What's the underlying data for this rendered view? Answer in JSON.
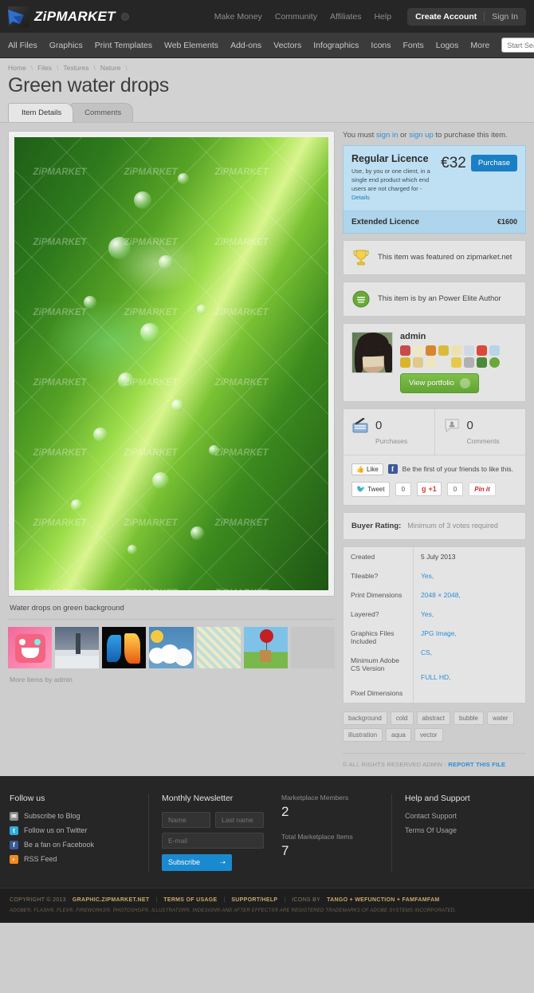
{
  "header": {
    "logo_text": "ZiPMARKET",
    "top_links": [
      "Make Money",
      "Community",
      "Affiliates",
      "Help"
    ],
    "create_account": "Create Account",
    "sign_in": "Sign In"
  },
  "nav": {
    "items": [
      "All Files",
      "Graphics",
      "Print Templates",
      "Web Elements",
      "Add-ons",
      "Vectors",
      "Infographics",
      "Icons",
      "Fonts",
      "Logos",
      "More"
    ],
    "search_placeholder": "Start Searching...",
    "search_value": ""
  },
  "breadcrumb": [
    "Home",
    "Files",
    "Textures",
    "Nature"
  ],
  "page_title": "Green water drops",
  "tabs": [
    {
      "label": "Item Details",
      "active": true
    },
    {
      "label": "Comments",
      "active": false
    }
  ],
  "preview": {
    "watermark": "ZiPMARKET",
    "caption": "Water drops on green background",
    "more_items": "More items by admin"
  },
  "purchase": {
    "notice_prefix": "You must ",
    "sign_in": "sign in",
    "notice_mid": " or ",
    "sign_up": "sign up",
    "notice_suffix": " to purchase this item.",
    "regular_title": "Regular Licence",
    "regular_desc": "Use, by you or one client, in a single end product which end users are not charged for -",
    "details_link": "Details",
    "regular_price": "€32",
    "purchase_label": "Purchase",
    "extended_title": "Extended Licence",
    "extended_price": "€1600"
  },
  "badges": {
    "featured": "This item was featured on zipmarket.net",
    "elite": "This item is by an Power Elite Author"
  },
  "author": {
    "name": "admin",
    "portfolio_label": "View portfolio",
    "badge_colors": [
      "#c94a4a",
      "#e8d88a",
      "#d9852e",
      "#d9bb3a",
      "#eae3b0",
      "#cfd9e2",
      "#d94a3a",
      "#b8d4e8",
      "#d9b52e",
      "#e0c98a",
      "#efe6c0",
      "#e4e4e4",
      "#e8c84a",
      "#b0b0b0",
      "#4a8a3a",
      "#6aa83a"
    ]
  },
  "stats": {
    "purchases_count": "0",
    "purchases_label": "Purchases",
    "comments_count": "0",
    "comments_label": "Comments"
  },
  "social": {
    "like_label": "Like",
    "fb_note": "Be the first of your friends to like this.",
    "tweet_label": "Tweet",
    "tweet_count": "0",
    "gplus_label": "+1",
    "gplus_count": "0",
    "pin_label": "Pin it"
  },
  "rating": {
    "label": "Buyer Rating:",
    "value": "Minimum of 3 votes required"
  },
  "attributes": [
    {
      "name": "Created",
      "value": "5 July 2013",
      "link": false
    },
    {
      "name": "Tileable?",
      "value": "Yes,",
      "link": true
    },
    {
      "name": "Print Dimensions",
      "value": "2048 × 2048,",
      "link": true
    },
    {
      "name": "Layered?",
      "value": "Yes,",
      "link": true
    },
    {
      "name": "Graphics Files Included",
      "value": "JPG Image,",
      "link": true
    },
    {
      "name": "Minimum Adobe CS Version",
      "value": "CS,",
      "link": true
    },
    {
      "name": "Pixel Dimensions",
      "value": "FULL HD,",
      "link": true
    }
  ],
  "tags": [
    "background",
    "cold",
    "abstract",
    "bubble",
    "water",
    "illustration",
    "aqua",
    "vector"
  ],
  "rights": {
    "text": "© ALL RIGHTS RESERVED ADMIN - ",
    "report_link": "REPORT THIS FILE"
  },
  "footer": {
    "follow_head": "Follow us",
    "follow_links": [
      {
        "label": "Subscribe to Blog",
        "color": "#8a8a8a",
        "glyph": "✉"
      },
      {
        "label": "Follow us on Twitter",
        "color": "#2daae1",
        "glyph": "t"
      },
      {
        "label": "Be a fan on Facebook",
        "color": "#3b5998",
        "glyph": "f"
      },
      {
        "label": "RSS Feed",
        "color": "#f28a1e",
        "glyph": "◔"
      }
    ],
    "newsletter_head": "Monthly Newsletter",
    "name_placeholder": "Name",
    "lastname_placeholder": "Last name",
    "email_placeholder": "E-mail",
    "subscribe_label": "Subscribe",
    "members_label": "Marketplace Members",
    "members_count": "2",
    "items_label": "Total Marketplace Items",
    "items_count": "7",
    "help_head": "Help and Support",
    "help_links": [
      "Contact Support",
      "Terms Of Usage"
    ]
  },
  "bottom": {
    "copyright_pre": "COPYRIGHT © 2013",
    "site": "GRAPHIC.ZIPMARKET.NET",
    "terms": "TERMS OF USAGE",
    "support": "SUPPORT/HELP",
    "icons_pre": "ICONS BY",
    "icons_credit": "TANGO + WEFUNCTION + FAMFAMFAM",
    "trademark": "ADOBE®, FLASH®, FLEX®, FIREWORKS®, PHOTOSHOP®, ILLUSTRATOR®, INDESIGN® AND AFTER EFFECTS® ARE REGISTERED TRADEMARKS OF ADOBE SYSTEMS INCORPORATED."
  }
}
